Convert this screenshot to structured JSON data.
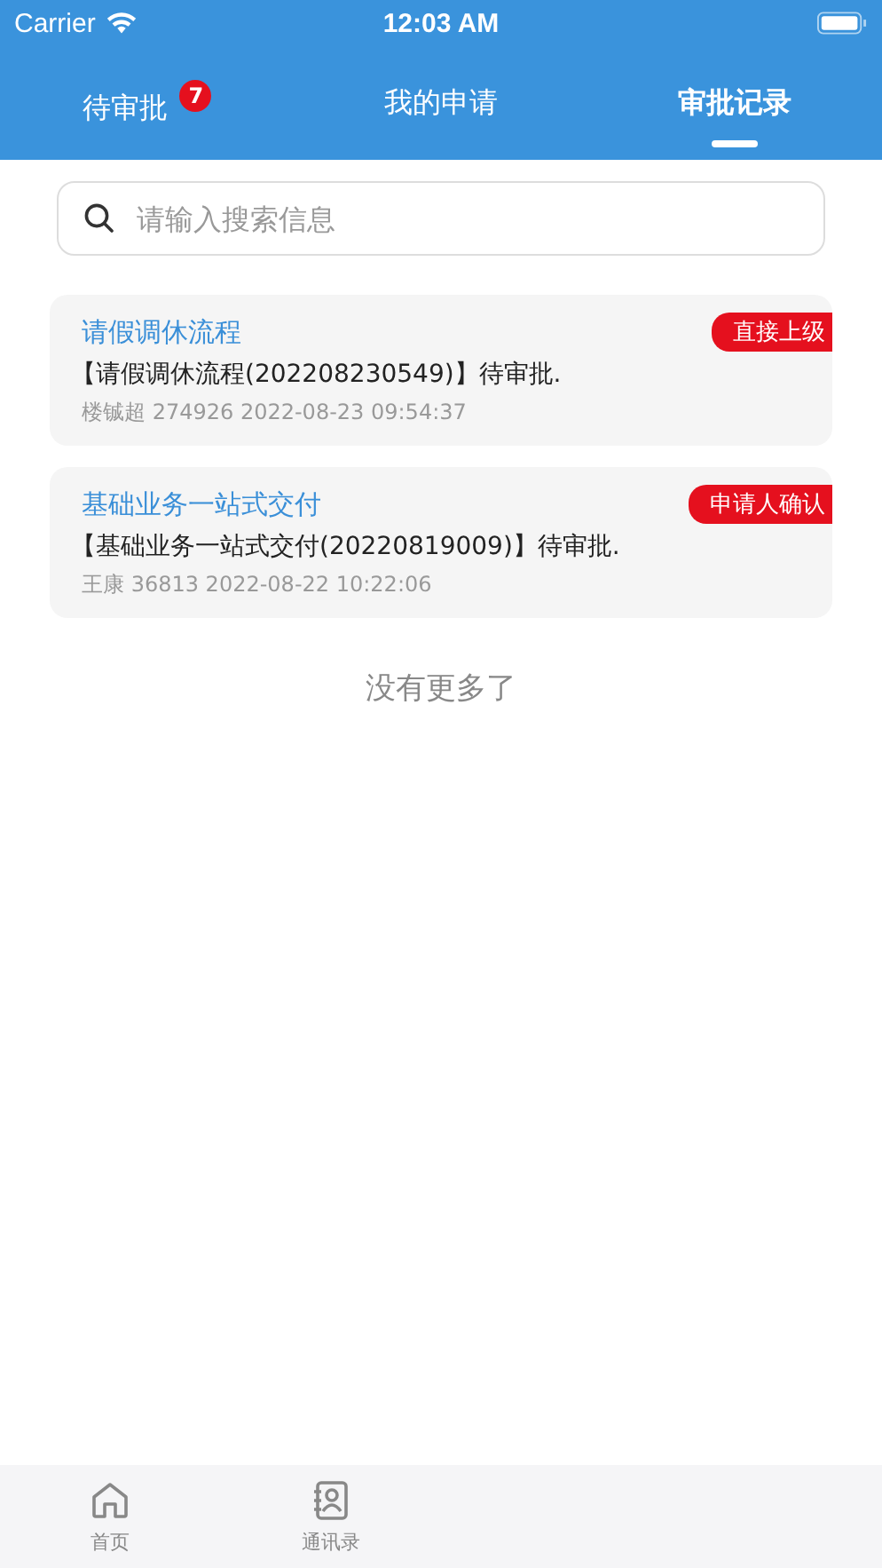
{
  "status_bar": {
    "carrier": "Carrier",
    "time": "12:03 AM"
  },
  "tabs": [
    {
      "label": "待审批",
      "badge": "7",
      "selected": false
    },
    {
      "label": "我的申请",
      "selected": false
    },
    {
      "label": "审批记录",
      "selected": true
    }
  ],
  "search": {
    "placeholder": "请输入搜索信息"
  },
  "records": [
    {
      "title": "请假调休流程",
      "tag": "直接上级",
      "message": "【请假调休流程(202208230549)】待审批.",
      "meta": "楼铖超 274926 2022-08-23 09:54:37"
    },
    {
      "title": "基础业务一站式交付",
      "tag": "申请人确认",
      "message": "【基础业务一站式交付(20220819009)】待审批.",
      "meta": "王康 36813 2022-08-22 10:22:06"
    }
  ],
  "end_text": "没有更多了",
  "bottom_nav": [
    {
      "label": "首页",
      "kind": "home",
      "selected": false
    },
    {
      "label": "通讯录",
      "kind": "contacts",
      "selected": false
    }
  ]
}
